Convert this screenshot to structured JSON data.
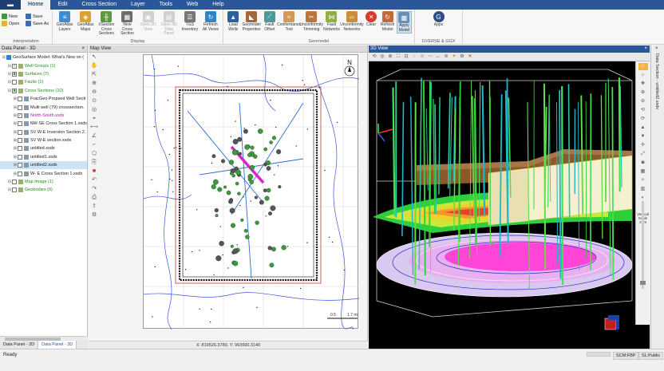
{
  "menubar": {
    "app_button": "▬",
    "items": [
      "Home",
      "Edit",
      "Cross Section",
      "Layer",
      "Tools",
      "Web",
      "Help"
    ]
  },
  "ribbon": {
    "interpretation": {
      "label": "Interpretation",
      "new": "New",
      "save": "Save",
      "open": "Open",
      "save_as": "Save As"
    },
    "display": {
      "label": "Display",
      "buttons": [
        "GeoAtlas Layers",
        "GeoAtlas Maps",
        "XSection Cross Sections",
        "New Cross Section",
        "Open 3D View",
        "Open 3D Data Panel",
        "TGS Inventory",
        "Refresh All Views"
      ]
    },
    "geomodel": {
      "label": "Geomodel",
      "buttons": [
        "Load Wells",
        "Geomodel Properties",
        "Fault Offset",
        "Conformance Tool",
        "Unconformity Trimming",
        "Fault Networks",
        "Unconformity Networks",
        "Clear",
        "Refresh Model",
        "Apply Model"
      ]
    },
    "gverse": {
      "label": "GVERSE & GGX",
      "buttons": [
        "Apps"
      ]
    }
  },
  "left_panel": {
    "title": "Data Panel - 3D",
    "close": "×",
    "tree": [
      {
        "text": "GeoSurface Model: What's New on (",
        "indent": 0,
        "style": "",
        "check": ""
      },
      {
        "text": "Well Groups (1)",
        "indent": 1,
        "style": "green",
        "check": "✓"
      },
      {
        "text": "Surfaces (7)",
        "indent": 1,
        "style": "green",
        "check": "■"
      },
      {
        "text": "Faults (1)",
        "indent": 1,
        "style": "green",
        "check": ""
      },
      {
        "text": "Cross Sections (10)",
        "indent": 1,
        "style": "green",
        "check": "■"
      },
      {
        "text": "FracGeo Propsed Well Secti",
        "indent": 2,
        "style": "",
        "check": ""
      },
      {
        "text": "Multi well (79) crosssection.",
        "indent": 2,
        "style": "",
        "check": ""
      },
      {
        "text": "North-South.xsdx",
        "indent": 2,
        "style": "magenta",
        "check": "✓"
      },
      {
        "text": "NW-SE Cross Section 1.xsdx",
        "indent": 2,
        "style": "",
        "check": ""
      },
      {
        "text": "SV W-E Inversion Section 2.",
        "indent": 2,
        "style": "",
        "check": ""
      },
      {
        "text": "SV W-E section.xsdx",
        "indent": 2,
        "style": "",
        "check": ""
      },
      {
        "text": "untitled.xsdx",
        "indent": 2,
        "style": "",
        "check": ""
      },
      {
        "text": "untitled1.xsdx",
        "indent": 2,
        "style": "",
        "check": ""
      },
      {
        "text": "untitled2.xsdx",
        "indent": 2,
        "style": "sel",
        "check": ""
      },
      {
        "text": "W- E Cross Section 1.xsdx",
        "indent": 2,
        "style": "",
        "check": ""
      },
      {
        "text": "Map Image (1)",
        "indent": 1,
        "style": "green",
        "check": ""
      },
      {
        "text": "Geobodies (0)",
        "indent": 1,
        "style": "green",
        "check": ""
      }
    ],
    "tabs": [
      "Data Panel - 2D",
      "Data Panel - 3D"
    ]
  },
  "map_view": {
    "title": "Map View",
    "north": "N",
    "scale_labels": [
      "0.5",
      "1.7 mi"
    ],
    "coords": "X: 819526.3789, Y: 963990.3140"
  },
  "view_3d": {
    "title": "3D View",
    "close": "×",
    "vertical_scale_label": "Vertical Scale",
    "vertical_scale_value": "2.49"
  },
  "right_strip": {
    "text": "Data Section - untitled2.xsdx",
    "close": "×"
  },
  "status": {
    "ready": "Ready",
    "scm": "SCM:FBP",
    "sl": "SL:Public"
  },
  "colors": {
    "accent": "#2b579a",
    "well_green": "#2fd13a",
    "section_magenta": "#e020d0",
    "map_border_red": "#d23030"
  }
}
